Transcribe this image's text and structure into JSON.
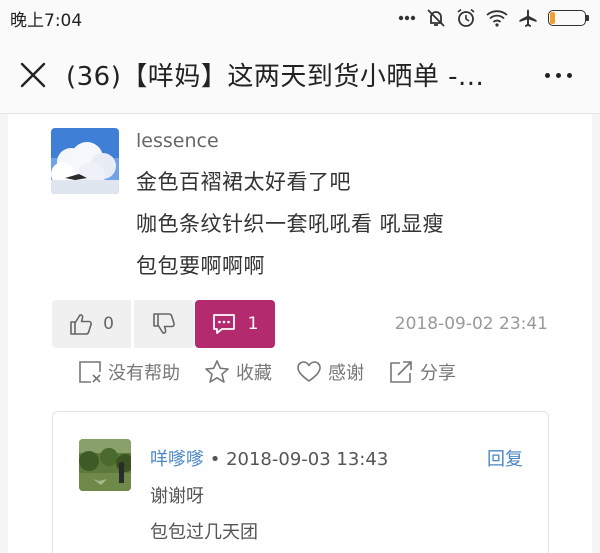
{
  "status_bar": {
    "time": "晚上7:04",
    "icons": [
      "more-dots-icon",
      "mute-icon",
      "alarm-icon",
      "wifi-icon",
      "airplane-icon",
      "battery-icon"
    ],
    "battery_level": 0.14,
    "battery_color": "#f2a12e"
  },
  "header": {
    "title": "(36)【咩妈】这两天到货小晒单 -...",
    "close_icon": "close-icon",
    "more_icon": "more-icon"
  },
  "comment": {
    "username": "lessence",
    "lines": [
      "金色百褶裙太好看了吧",
      "咖色条纹针织一套吼吼看 吼显瘦",
      "包包要啊啊啊"
    ],
    "like_count": "0",
    "reply_count": "1",
    "timestamp": "2018-09-02 23:41",
    "accent_color": "#b42a6e"
  },
  "tools": {
    "unhelpful": "没有帮助",
    "favorite": "收藏",
    "thanks": "感谢",
    "share": "分享"
  },
  "reply": {
    "username": "咩嗲嗲",
    "separator": " • ",
    "timestamp": "2018-09-03 13:43",
    "reply_label": "回复",
    "lines": [
      "谢谢呀",
      "包包过几天团"
    ],
    "link_color": "#4b86c5"
  }
}
